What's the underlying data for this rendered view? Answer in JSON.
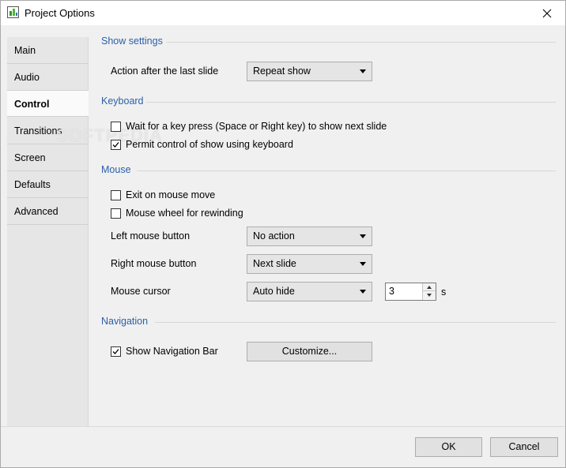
{
  "window": {
    "title": "Project Options",
    "icon": "app-chart-icon"
  },
  "sidebar": {
    "items": [
      {
        "label": "Main",
        "active": false
      },
      {
        "label": "Audio",
        "active": false
      },
      {
        "label": "Control",
        "active": true
      },
      {
        "label": "Transitions",
        "active": false
      },
      {
        "label": "Screen",
        "active": false
      },
      {
        "label": "Defaults",
        "active": false
      },
      {
        "label": "Advanced",
        "active": false
      }
    ]
  },
  "show_settings": {
    "title": "Show settings",
    "action_label": "Action after the last slide",
    "action_value": "Repeat show"
  },
  "keyboard": {
    "title": "Keyboard",
    "wait_key_label": "Wait for a key press (Space or Right key) to show next slide",
    "wait_key_checked": false,
    "permit_control_label": "Permit control of show using keyboard",
    "permit_control_checked": true
  },
  "mouse": {
    "title": "Mouse",
    "exit_move_label": "Exit on mouse move",
    "exit_move_checked": false,
    "wheel_label": "Mouse wheel for rewinding",
    "wheel_checked": false,
    "left_label": "Left mouse button",
    "left_value": "No action",
    "right_label": "Right mouse button",
    "right_value": "Next slide",
    "cursor_label": "Mouse cursor",
    "cursor_value": "Auto hide",
    "cursor_seconds": "3",
    "cursor_unit": "s"
  },
  "navigation": {
    "title": "Navigation",
    "show_bar_label": "Show Navigation Bar",
    "show_bar_checked": true,
    "customize_label": "Customize..."
  },
  "footer": {
    "ok_label": "OK",
    "cancel_label": "Cancel"
  },
  "watermark": "SOFTPEDIA",
  "colors": {
    "section_title": "#2b5fa8",
    "panel_bg": "#f0f0f0",
    "sidebar_bg": "#e6e6e6"
  }
}
